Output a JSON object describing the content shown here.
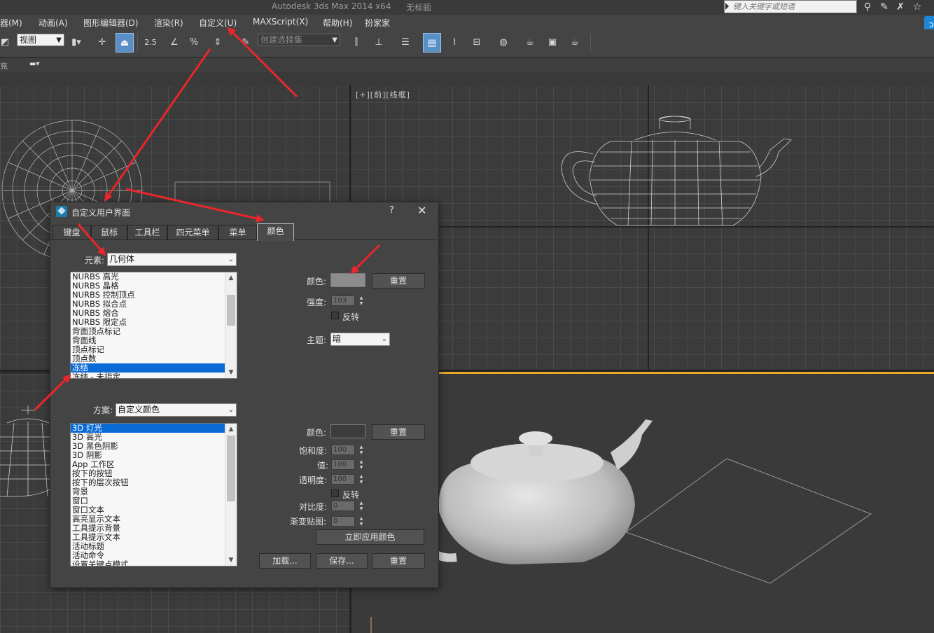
{
  "titlebar": {
    "app_title": "Autodesk 3ds Max  2014 x64",
    "doc_title": "无标题",
    "search_placeholder": "键入关键字或短语",
    "icons": [
      "binoculars-icon",
      "wrench-icon",
      "help-icon",
      "star-icon"
    ]
  },
  "menubar": {
    "items": [
      "器(M)",
      "动画(A)",
      "图形编辑器(D)",
      "渲染(R)",
      "自定义(U)",
      "MAXScript(X)",
      "帮助(H)",
      "扮家家"
    ]
  },
  "toolbar": {
    "view_dropdown": "视图",
    "selection_set_placeholder": "创建选择集",
    "snap_angle": "2.5",
    "percent": "%"
  },
  "ribbon": {
    "label": "充"
  },
  "viewports": {
    "front_label": "[+][前][线框]"
  },
  "dialog": {
    "title": "自定义用户界面",
    "help": "?",
    "close": "✕",
    "tabs": [
      "键盘",
      "鼠标",
      "工具栏",
      "四元菜单",
      "菜单",
      "颜色"
    ],
    "active_tab": "颜色",
    "element_label": "元素:",
    "element_value": "几何体",
    "element_items": [
      "NURBS 高光",
      "NURBS 晶格",
      "NURBS 控制顶点",
      "NURBS 拟合点",
      "NURBS 熔合",
      "NURBS 限定点",
      "背面顶点标记",
      "背面线",
      "顶点标记",
      "顶点数",
      "冻结",
      "冻结 - 未指定"
    ],
    "element_selected": "冻结",
    "color_label": "颜色:",
    "reset_label": "重置",
    "intensity_label": "强度:",
    "intensity_value": "103",
    "invert_label": "反转",
    "theme_label": "主题:",
    "theme_value": "暗",
    "scheme_label": "方案:",
    "scheme_value": "自定义颜色",
    "scheme_items": [
      "3D 灯光",
      "3D 高光",
      "3D 黑色阴影",
      "3D 阴影",
      "App 工作区",
      "按下的按钮",
      "按下的层次按钮",
      "背景",
      "窗口",
      "窗口文本",
      "高亮显示文本",
      "工具提示背景",
      "工具提示文本",
      "活动标题",
      "活动命令",
      "设置关键点模式"
    ],
    "scheme_selected": "3D 灯光",
    "color2_label": "颜色:",
    "reset2_label": "重置",
    "saturation_label": "饱和度:",
    "saturation_value": "100",
    "value_label": "值:",
    "value_value": "100",
    "transparency_label": "透明度:",
    "transparency_value": "100",
    "invert2_label": "反转",
    "contrast_label": "对比度:",
    "contrast_value": "0",
    "gradient_label": "渐变贴图:",
    "gradient_value": "0",
    "apply_now_label": "立即应用颜色",
    "load_label": "加载...",
    "save_label": "保存...",
    "reset3_label": "重置"
  },
  "colors": {
    "element_swatch": "#8c8c8c",
    "scheme_swatch": "#3c3c3c",
    "selection": "#0a6bd6",
    "annotation_arrow": "#e8262b",
    "active_viewport": "#e6a92b"
  }
}
